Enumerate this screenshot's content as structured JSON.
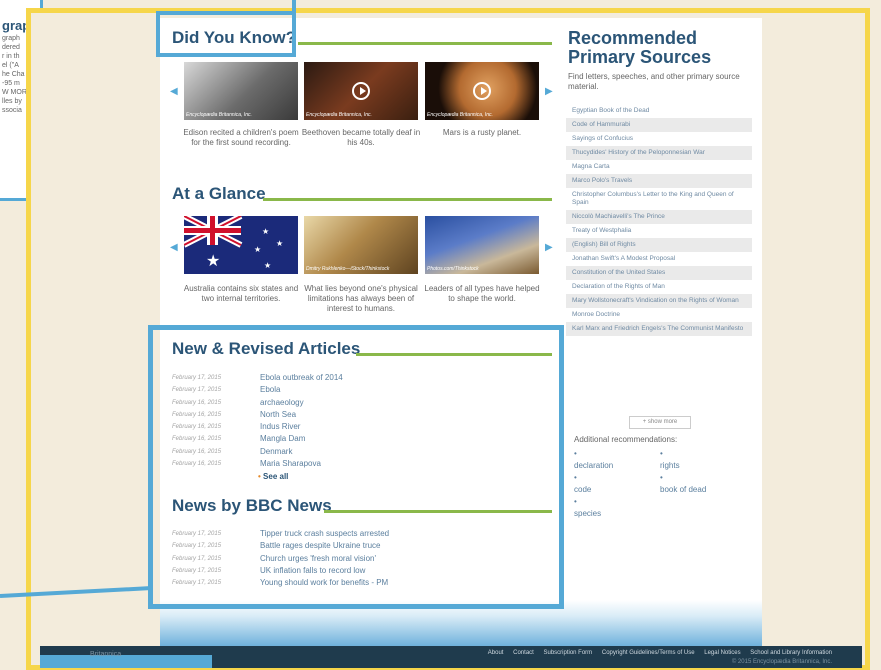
{
  "background_page": {
    "title": "grap",
    "lines": [
      "graph",
      "dered",
      "r in th",
      "el (\"A",
      "he Cha",
      "-95 m",
      "W MOR",
      "",
      "lles by",
      "ssocia"
    ]
  },
  "did_you_know": {
    "title": "Did You Know?",
    "tiles": [
      {
        "credit": "Encyclopædia Britannica, Inc.",
        "caption": "Edison recited a children's poem for the first sound recording."
      },
      {
        "credit": "Encyclopædia Britannica, Inc.",
        "caption": "Beethoven became totally deaf in his 40s."
      },
      {
        "credit": "Encyclopædia Britannica, Inc.",
        "caption": "Mars is a rusty planet."
      }
    ]
  },
  "at_a_glance": {
    "title": "At a Glance",
    "tiles": [
      {
        "credit": "",
        "caption": "Australia contains six states and two internal territories."
      },
      {
        "credit": "Dmitry Rukhlenko—iStock/Thinkstock",
        "caption": "What lies beyond one's physical limitations has always been of interest to humans."
      },
      {
        "credit": "Photos.com/Thinkstock",
        "caption": "Leaders of all types have helped to shape the world."
      }
    ]
  },
  "new_revised": {
    "title": "New & Revised Articles",
    "rows": [
      {
        "date": "February 17, 2015",
        "text": "Ebola outbreak of 2014"
      },
      {
        "date": "February 17, 2015",
        "text": "Ebola"
      },
      {
        "date": "February 16, 2015",
        "text": "archaeology"
      },
      {
        "date": "February 16, 2015",
        "text": "North Sea"
      },
      {
        "date": "February 16, 2015",
        "text": "Indus River"
      },
      {
        "date": "February 16, 2015",
        "text": "Mangla Dam"
      },
      {
        "date": "February 16, 2015",
        "text": "Denmark"
      },
      {
        "date": "February 16, 2015",
        "text": "Maria Sharapova"
      }
    ],
    "see_all": "See all"
  },
  "bbc": {
    "title": "News by BBC News",
    "rows": [
      {
        "date": "February 17, 2015",
        "text": "Tipper truck crash suspects arrested"
      },
      {
        "date": "February 17, 2015",
        "text": "Battle rages despite Ukraine truce"
      },
      {
        "date": "February 17, 2015",
        "text": "Church urges 'fresh moral vision'"
      },
      {
        "date": "February 17, 2015",
        "text": "UK inflation falls to record low"
      },
      {
        "date": "February 17, 2015",
        "text": "Young should work for benefits - PM"
      }
    ]
  },
  "recommended": {
    "title": "Recommended Primary Sources",
    "description": "Find letters, speeches, and other primary source material.",
    "items": [
      "Egyptian Book of the Dead",
      "Code of Hammurabi",
      "Sayings of Confucius",
      "Thucydides' History of the Peloponnesian War",
      "Magna Carta",
      "Marco Polo's Travels",
      "Christopher Columbus's Letter to the King and Queen of Spain",
      "Niccolò Machiavelli's The Prince",
      "Treaty of Westphalia",
      "(English) Bill of Rights",
      "Jonathan Swift's A Modest Proposal",
      "Constitution of the United States",
      "Declaration of the Rights of Man",
      "Mary Wollstonecraft's Vindication on the Rights of Woman",
      "Monroe Doctrine",
      "Karl Marx and Friedrich Engels's The Communist Manifesto"
    ],
    "show_more": "+ show more",
    "additional_label": "Additional recommendations:",
    "tags_left": [
      "declaration",
      "code",
      "species"
    ],
    "tags_right": [
      "rights",
      "book of dead"
    ]
  },
  "footer": {
    "logo": "Britannica",
    "links": [
      "About",
      "Contact",
      "Subscription Form",
      "Copyright Guidelines/Terms of Use",
      "Legal Notices",
      "School and Library Information"
    ],
    "copyright": "© 2015 Encyclopædia Britannica, Inc."
  }
}
